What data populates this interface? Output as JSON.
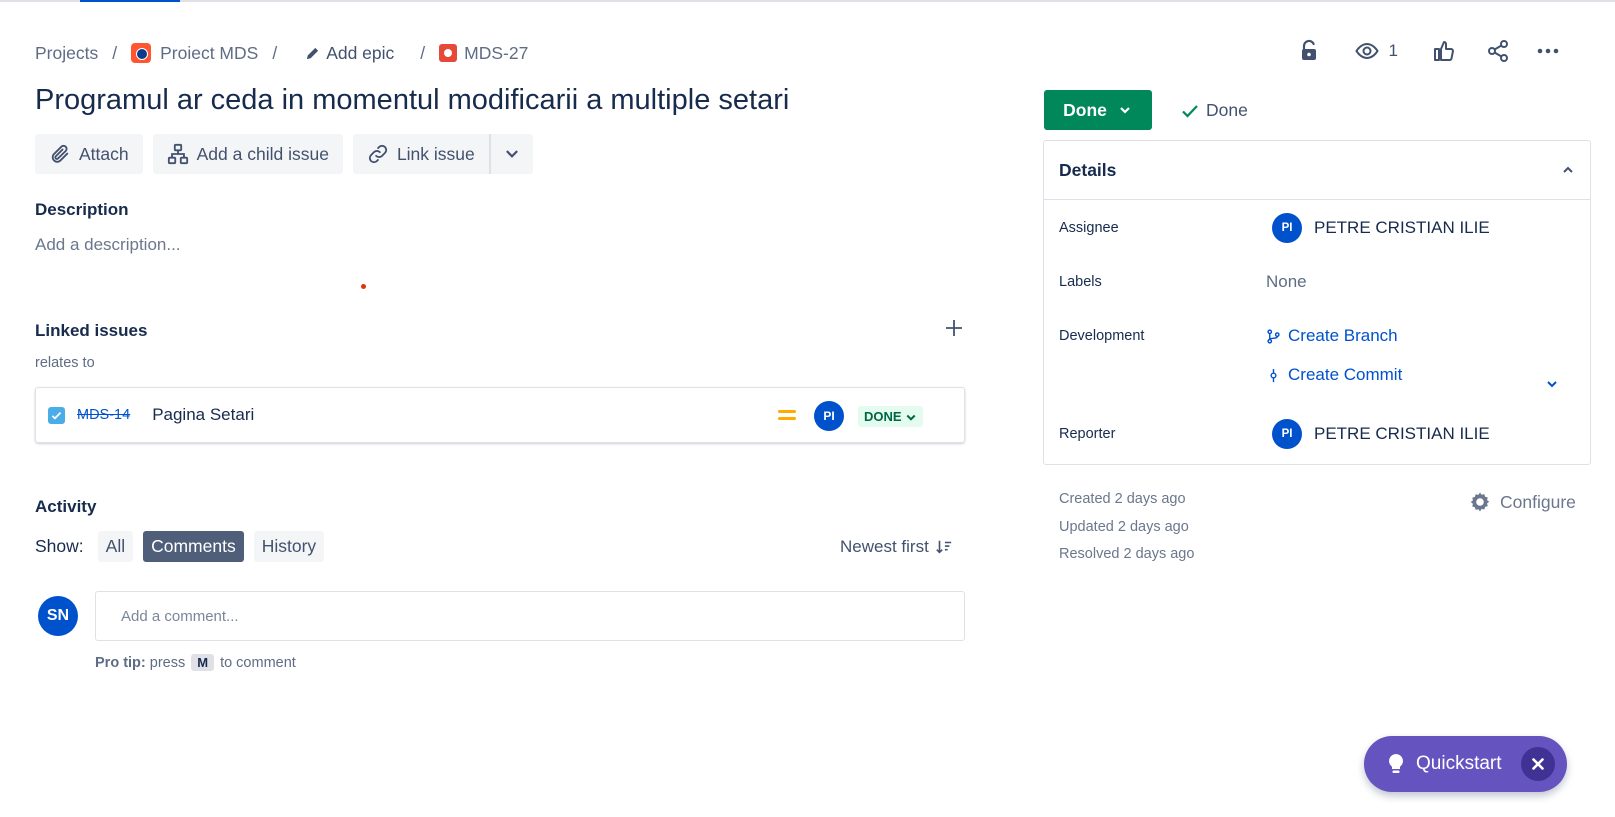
{
  "breadcrumb": {
    "projects": "Projects",
    "separator": "/",
    "project_name": "Proiect MDS",
    "add_epic": "Add epic",
    "issue_key": "MDS-27"
  },
  "top_actions": {
    "watch_count": "1",
    "icons": [
      "lock-icon",
      "eye-icon",
      "like-icon",
      "share-icon",
      "more-icon"
    ]
  },
  "issue": {
    "title": "Programul ar ceda in momentul modificarii a multiple setari"
  },
  "action_buttons": {
    "attach": "Attach",
    "add_child": "Add a child issue",
    "link_issue": "Link issue"
  },
  "description": {
    "heading": "Description",
    "placeholder": "Add a description..."
  },
  "linked_issues": {
    "heading": "Linked issues",
    "relation": "relates to",
    "items": [
      {
        "key": "MDS-14",
        "summary": "Pagina Setari",
        "assignee_initials": "PI",
        "status": "DONE",
        "priority_color": "#ffab00"
      }
    ]
  },
  "activity": {
    "heading": "Activity",
    "show_label": "Show:",
    "filters": [
      "All",
      "Comments",
      "History"
    ],
    "active_filter": "Comments",
    "sort": "Newest first",
    "user_initials": "SN",
    "comment_placeholder": "Add a comment...",
    "protip_bold": "Pro tip:",
    "protip_press": "press",
    "protip_key": "M",
    "protip_tail": "to comment"
  },
  "status": {
    "button": "Done",
    "resolution": "Done",
    "color": "#00875a"
  },
  "details": {
    "heading": "Details",
    "assignee_label": "Assignee",
    "assignee_initials": "PI",
    "assignee_name": "PETRE CRISTIAN ILIE",
    "labels_label": "Labels",
    "labels_value": "None",
    "development_label": "Development",
    "create_branch": "Create Branch",
    "create_commit": "Create Commit",
    "reporter_label": "Reporter",
    "reporter_initials": "PI",
    "reporter_name": "PETRE CRISTIAN ILIE"
  },
  "meta": {
    "created": "Created 2 days ago",
    "updated": "Updated 2 days ago",
    "resolved": "Resolved 2 days ago",
    "configure": "Configure"
  },
  "quickstart": {
    "label": "Quickstart",
    "color": "#6554c0"
  }
}
